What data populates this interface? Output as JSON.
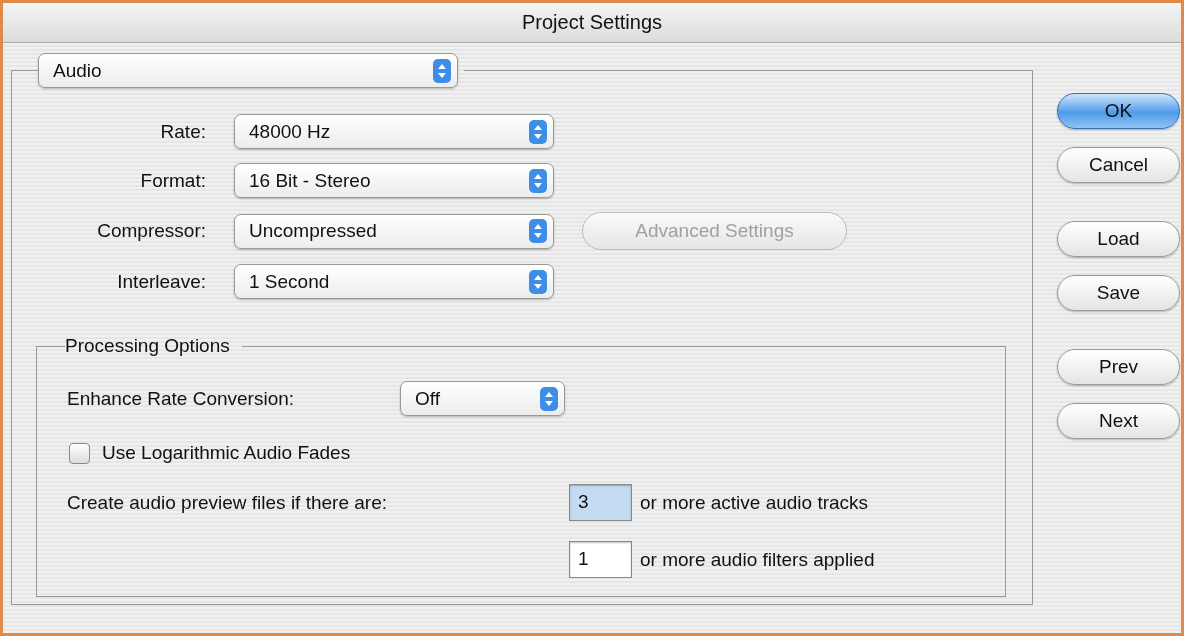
{
  "window": {
    "title": "Project Settings"
  },
  "section_menu": {
    "value": "Audio"
  },
  "settings": [
    {
      "label": "Rate:",
      "value": "48000 Hz"
    },
    {
      "label": "Format:",
      "value": "16 Bit - Stereo"
    },
    {
      "label": "Compressor:",
      "value": "Uncompressed"
    },
    {
      "label": "Interleave:",
      "value": "1 Second"
    }
  ],
  "advanced_button": {
    "label": "Advanced Settings",
    "disabled": true
  },
  "processing": {
    "title": "Processing Options",
    "enhance": {
      "label": "Enhance Rate Conversion:",
      "value": "Off"
    },
    "log_fades": {
      "label": "Use Logarithmic Audio Fades",
      "checked": false
    },
    "preview": [
      {
        "label": "Create audio preview files if there are:",
        "value": "3",
        "suffix": "or more active audio tracks",
        "selected": true
      },
      {
        "value": "1",
        "suffix": "or more audio filters applied",
        "selected": false
      }
    ]
  },
  "button_groups": [
    [
      {
        "label": "OK",
        "default": true
      },
      {
        "label": "Cancel",
        "default": false
      }
    ],
    [
      {
        "label": "Load",
        "default": false
      },
      {
        "label": "Save",
        "default": false
      }
    ],
    [
      {
        "label": "Prev",
        "default": false
      },
      {
        "label": "Next",
        "default": false
      }
    ]
  ]
}
